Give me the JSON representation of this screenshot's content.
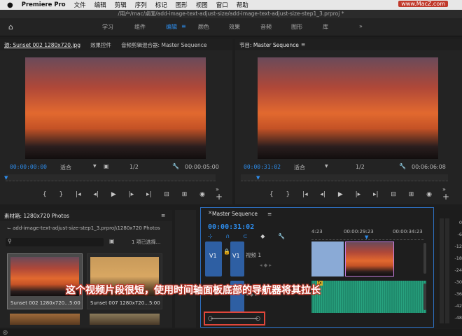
{
  "menubar": {
    "app": "Premiere Pro",
    "items": [
      "文件",
      "编辑",
      "剪辑",
      "序列",
      "标记",
      "图形",
      "视图",
      "窗口",
      "帮助"
    ],
    "watermark": "www.MacZ.com"
  },
  "titlebar": {
    "path": "/用户/mac/桌面/add-image-text-adjust-size/add-image-text-adjust-size-step1_3.prproj *"
  },
  "workspaces": {
    "tabs": [
      "学习",
      "组件",
      "编辑",
      "颜色",
      "效果",
      "音频",
      "图形",
      "库"
    ],
    "active": "编辑",
    "more": "»"
  },
  "source": {
    "tab1": "源: Sunset 002 1280x720.jpg",
    "tab2": "效果控件",
    "tab3": "音频剪辑混合器: Master Sequence",
    "timecode": "00:00:00:00",
    "fit": "适合",
    "ratio": "1/2",
    "duration": "00:00:05:00"
  },
  "program": {
    "title": "节目: Master Sequence",
    "timecode": "00:00:31:02",
    "fit": "适合",
    "ratio": "1/2",
    "duration": "00:06:06:08"
  },
  "project": {
    "title": "素材箱: 1280x720 Photos",
    "path": "add-image-text-adjust-size-step1_3.prproj\\1280x720 Photos",
    "selected": "1 项已选择...",
    "items": [
      {
        "name": "Sunset 002 1280x720...",
        "dur": "5:00"
      },
      {
        "name": "Sunset 007 1280x720...",
        "dur": "5:00"
      }
    ]
  },
  "timeline": {
    "title": "Master Sequence",
    "timecode": "00:00:31:02",
    "ticks": [
      "4:23",
      "00:00:29:23",
      "00:00:34:23"
    ],
    "track_v1": "V1",
    "track_video": "视频 1",
    "track_a1": "A1"
  },
  "meters": {
    "labels": [
      "0",
      "-6",
      "-12",
      "-18",
      "-24",
      "-30",
      "-36",
      "-42",
      "-48"
    ]
  },
  "caption": "这个视频片段很短，使用时间轴面板底部的导航器将其拉长",
  "colors": {
    "accent": "#2d8ceb",
    "highlight": "#e0463a",
    "clip": "#2e5fa3",
    "audio": "#1f8a6c"
  }
}
